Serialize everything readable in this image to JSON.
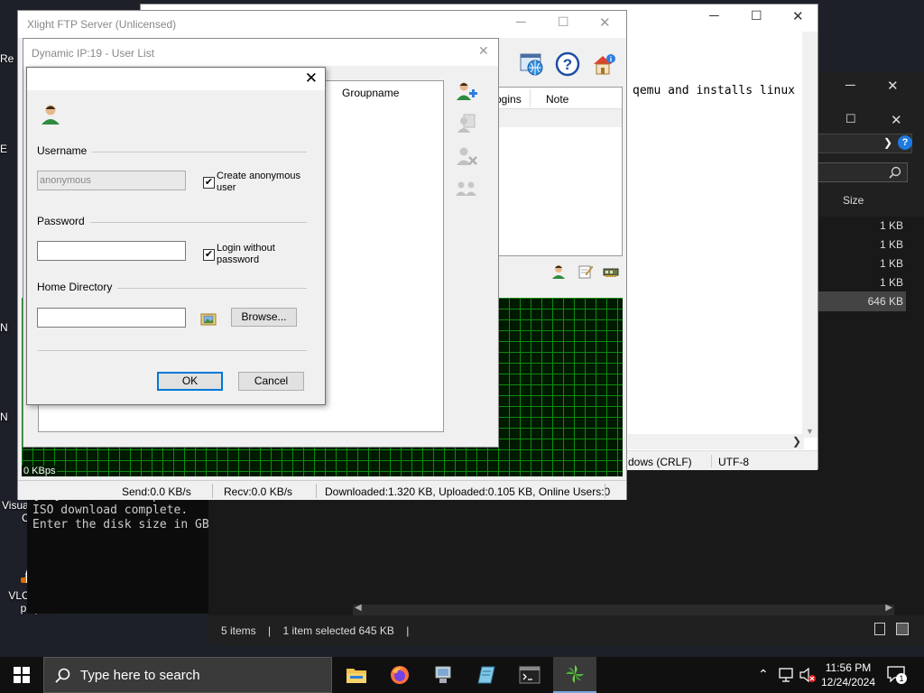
{
  "desktop": {
    "vlc_label_line1": "VLC media",
    "vlc_label_line2": "player",
    "partial_visual_line1": "Visual",
    "partial_visual_line2": "Co",
    "partial_r": "Re",
    "partial_e": "E",
    "partial_n1": "N",
    "partial_n2": "N"
  },
  "terminal": {
    "lines": [
      "[OK] Download completed.",
      "ISO download complete.",
      "Enter the disk size in GB"
    ]
  },
  "notepad": {
    "text": "qemu and installs linux",
    "status_eol": "dows (CRLF)",
    "status_encoding": "UTF-8"
  },
  "explorer": {
    "size_header": "Size",
    "sizes": [
      "1 KB",
      "1 KB",
      "1 KB",
      "1 KB",
      "646 KB"
    ],
    "status_items": "5 items",
    "status_selected": "1 item selected  645 KB"
  },
  "xlight": {
    "title": "Xlight FTP Server (Unlicensed)",
    "list_col_logins": "ogins",
    "list_col_note": "Note",
    "graph_label": "0 KBps",
    "status_send": "Send:0.0 KB/s",
    "status_recv": "Recv:0.0 KB/s",
    "status_transfer": "Downloaded:1.320 KB, Uploaded:0.105 KB, Online Users:0"
  },
  "user_list": {
    "title": "Dynamic IP:19 - User List",
    "col_groupname": "Groupname"
  },
  "dialog": {
    "username_label": "Username",
    "username_value": "anonymous",
    "create_anonymous_label_1": "Create anonymous",
    "create_anonymous_label_2": "user",
    "create_anonymous_checked": true,
    "password_label": "Password",
    "password_value": "",
    "login_without_password_label_1": "Login without",
    "login_without_password_label_2": "password",
    "login_without_password_checked": true,
    "home_directory_label": "Home Directory",
    "home_directory_value": "",
    "browse_label": "Browse...",
    "ok_label": "OK",
    "cancel_label": "Cancel"
  },
  "taskbar": {
    "search_placeholder": "Type here to search",
    "time": "11:56 PM",
    "date": "12/24/2024",
    "notification_count": "1"
  },
  "colors": {
    "graph_grid": "#0e8a0e",
    "graph_bg": "#001a00",
    "default_button_border": "#0078d7",
    "taskbar_bg": "#101010"
  }
}
